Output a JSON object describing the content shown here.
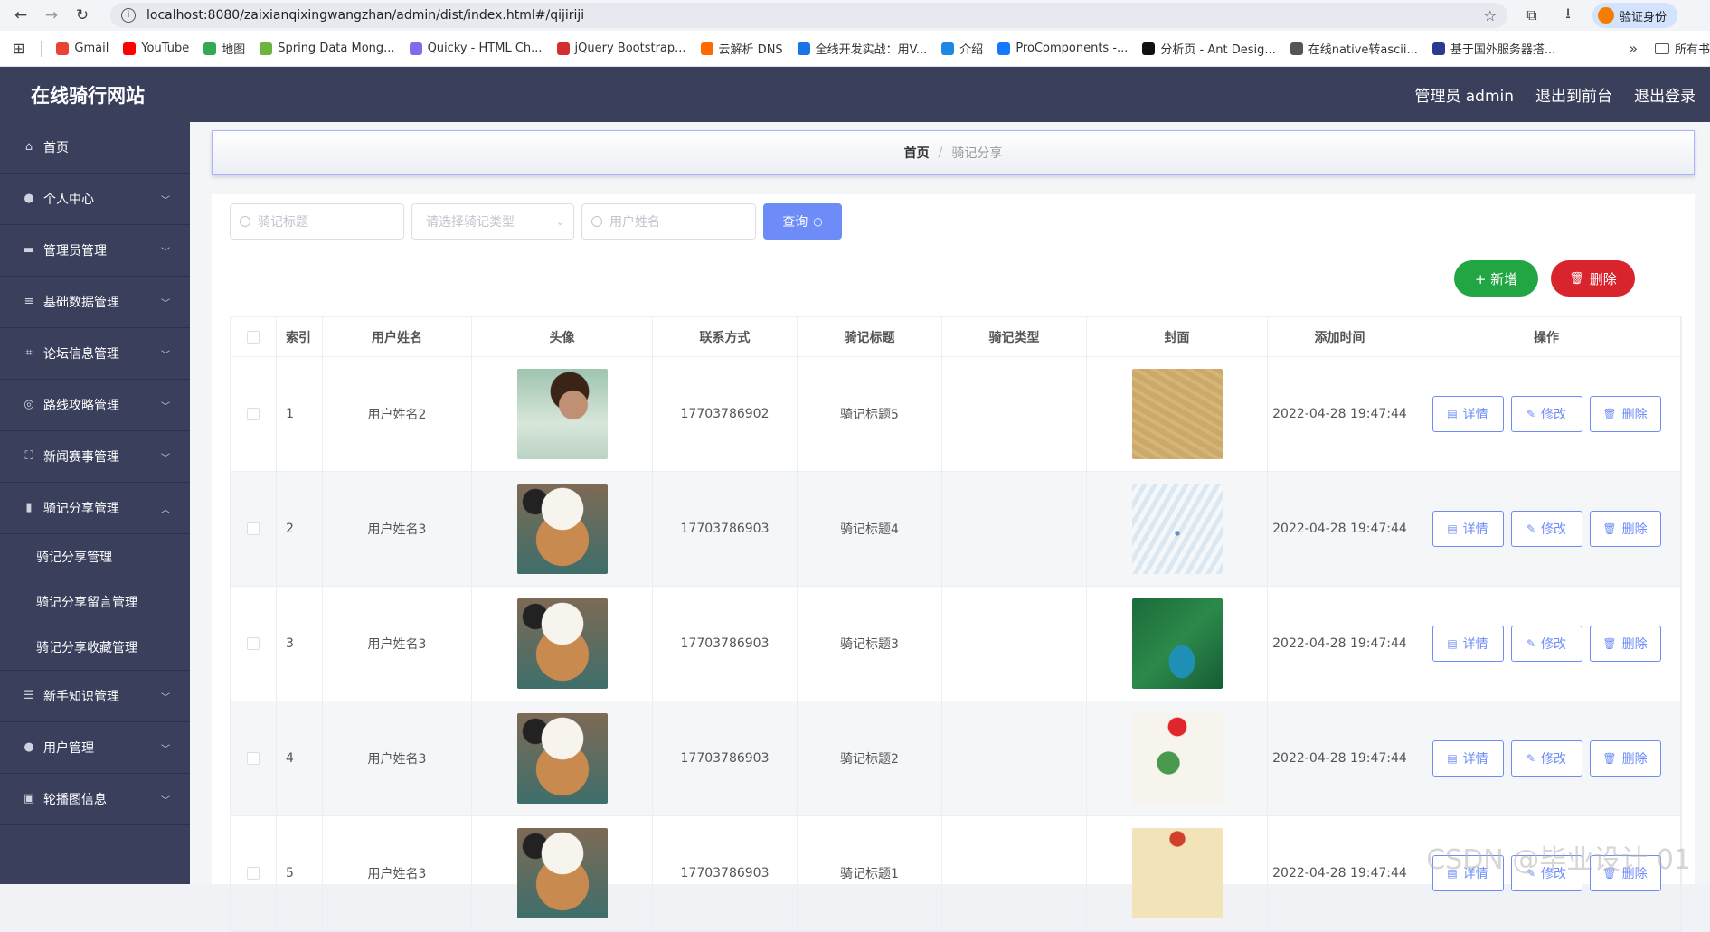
{
  "browser": {
    "url": "localhost:8080/zaixianqixingwangzhan/admin/dist/index.html#/qijiriji",
    "profile_label": "验证身份",
    "bookmarks": [
      "Gmail",
      "YouTube",
      "地图",
      "Spring Data Mong...",
      "Quicky - HTML Ch...",
      "jQuery Bootstrap...",
      "云解析 DNS",
      "全线开发实战：用V...",
      "介绍",
      "ProComponents -...",
      "分析页 - Ant Desig...",
      "在线native转ascii...",
      "基于国外服务器搭..."
    ],
    "bookmark_colors": [
      "#ea4335",
      "#ff0000",
      "#34a853",
      "#6db33f",
      "#7b6cf0",
      "#d32f2f",
      "#ff6a00",
      "#1a73e8",
      "#1e88e5",
      "#1677ff",
      "#111111",
      "#555555",
      "#2b3a8f"
    ],
    "bookmark_folder": "所有书"
  },
  "header": {
    "title": "在线骑行网站",
    "admin_label": "管理员 admin",
    "exit_front": "退出到前台",
    "logout": "退出登录"
  },
  "sidebar": {
    "items": [
      {
        "label": "首页",
        "icon": "home-icon"
      },
      {
        "label": "个人中心",
        "icon": "user-icon"
      },
      {
        "label": "管理员管理",
        "icon": "briefcase-icon"
      },
      {
        "label": "基础数据管理",
        "icon": "sliders-icon"
      },
      {
        "label": "论坛信息管理",
        "icon": "crop-icon"
      },
      {
        "label": "路线攻略管理",
        "icon": "compass-icon"
      },
      {
        "label": "新闻赛事管理",
        "icon": "fullscreen-icon"
      },
      {
        "label": "骑记分享管理",
        "icon": "chart-icon"
      },
      {
        "label": "新手知识管理",
        "icon": "menu-icon"
      },
      {
        "label": "用户管理",
        "icon": "user-icon"
      },
      {
        "label": "轮播图信息",
        "icon": "picture-icon"
      }
    ],
    "sub_items": [
      "骑记分享管理",
      "骑记分享留言管理",
      "骑记分享收藏管理"
    ]
  },
  "breadcrumb": {
    "home": "首页",
    "current": "骑记分享"
  },
  "search": {
    "title_placeholder": "骑记标题",
    "type_placeholder": "请选择骑记类型",
    "user_placeholder": "用户姓名",
    "query_label": "查询"
  },
  "actions": {
    "add_label": "+ 新增",
    "delete_label": "删除"
  },
  "table": {
    "headers": [
      "索引",
      "用户姓名",
      "头像",
      "联系方式",
      "骑记标题",
      "骑记类型",
      "封面",
      "添加时间",
      "操作"
    ],
    "rows": [
      {
        "index": "1",
        "name": "用户姓名2",
        "avatar": "girl",
        "phone": "17703786902",
        "title": "骑记标题5",
        "type": "",
        "cover": "c1",
        "time": "2022-04-28 19:47:44"
      },
      {
        "index": "2",
        "name": "用户姓名3",
        "avatar": "cat",
        "phone": "17703786903",
        "title": "骑记标题4",
        "type": "",
        "cover": "c2",
        "time": "2022-04-28 19:47:44"
      },
      {
        "index": "3",
        "name": "用户姓名3",
        "avatar": "cat",
        "phone": "17703786903",
        "title": "骑记标题3",
        "type": "",
        "cover": "c3",
        "time": "2022-04-28 19:47:44"
      },
      {
        "index": "4",
        "name": "用户姓名3",
        "avatar": "cat",
        "phone": "17703786903",
        "title": "骑记标题2",
        "type": "",
        "cover": "c4",
        "time": "2022-04-28 19:47:44"
      },
      {
        "index": "5",
        "name": "用户姓名3",
        "avatar": "cat",
        "phone": "17703786903",
        "title": "骑记标题1",
        "type": "",
        "cover": "c5",
        "time": "2022-04-28 19:47:44"
      }
    ],
    "op_labels": {
      "detail": "详情",
      "edit": "修改",
      "delete": "删除"
    }
  },
  "watermark": "CSDN @毕业设计 01",
  "colors": {
    "sidebar": "#3a3f5c",
    "primary": "#6d8cf7",
    "success": "#22a644",
    "danger": "#d9232d"
  }
}
